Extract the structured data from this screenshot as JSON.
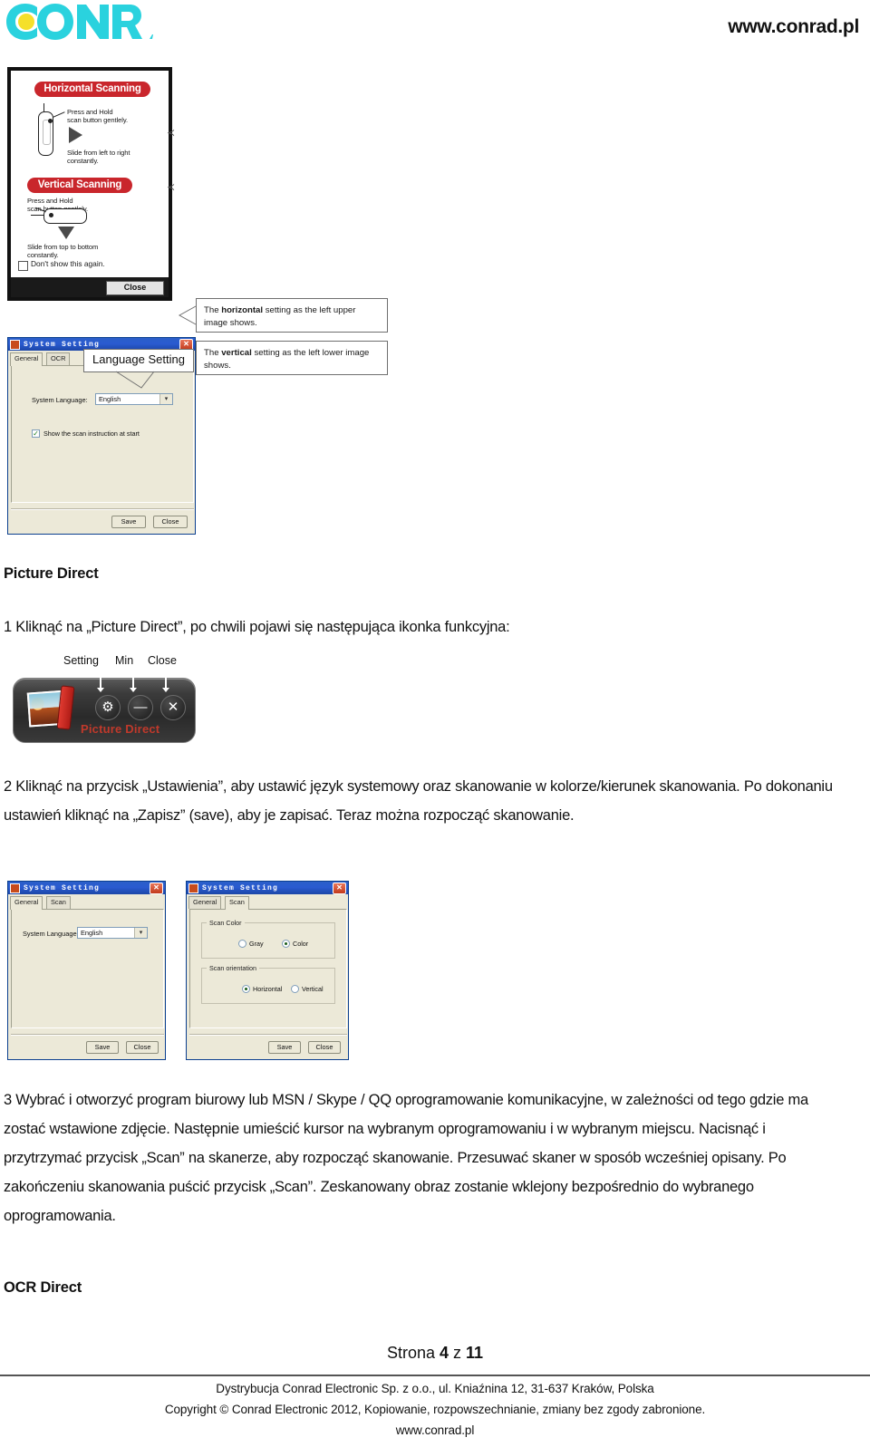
{
  "header": {
    "logo_text": "CONRAD",
    "logo_color": "#2ad2de",
    "logo_accent": "#f5e02a",
    "site_url": "www.conrad.pl"
  },
  "scan_instruction": {
    "horizontal_badge": "Horizontal Scanning",
    "horizontal_press": "Press and Hold",
    "horizontal_press2": "scan button gentlely.",
    "horizontal_slide": "Slide from left to right",
    "horizontal_slide2": "constantly.",
    "vertical_badge": "Vertical Scanning",
    "vertical_press": "Press and Hold",
    "vertical_press2": "scan button gentlely.",
    "vertical_slide": "Slide from top to bottom",
    "vertical_slide2": "constantly.",
    "dont_show": "Don't show this again.",
    "close_button": "Close",
    "badge_color": "#c9262c",
    "callouts": [
      {
        "prefix": "The ",
        "bold": "horizontal",
        "suffix": " setting as the left upper image shows."
      },
      {
        "prefix": "The ",
        "bold": "vertical",
        "suffix": " setting as the left lower image shows."
      }
    ]
  },
  "dialog_language": {
    "title": "System Setting",
    "tabs": [
      "General",
      "OCR"
    ],
    "active_tab": "General",
    "language_label": "System Language:",
    "language_value": "English",
    "checkbox_label": "Show the scan instruction at start",
    "checkbox_checked": true,
    "save_button": "Save",
    "close_button": "Close",
    "callout": "Language Setting"
  },
  "dialog_general": {
    "title": "System Setting",
    "tabs": [
      "General",
      "Scan"
    ],
    "active_tab": "General",
    "language_label": "System Language:",
    "language_value": "English",
    "save_button": "Save",
    "close_button": "Close"
  },
  "dialog_scan": {
    "title": "System Setting",
    "tabs": [
      "General",
      "Scan"
    ],
    "active_tab": "Scan",
    "group_color": "Scan Color",
    "color_options": [
      "Gray",
      "Color"
    ],
    "color_selected": "Color",
    "group_orientation": "Scan orientation",
    "orientation_options": [
      "Horizontal",
      "Vertical"
    ],
    "orientation_selected": "Horizontal",
    "save_button": "Save",
    "close_button": "Close"
  },
  "picture_direct_widget": {
    "label_setting": "Setting",
    "label_min": "Min",
    "label_close": "Close",
    "title": "Picture Direct",
    "title_color": "#c0392b",
    "gear_icon": "gear-icon",
    "minus_icon": "minus-icon",
    "close_icon": "close-icon"
  },
  "content": {
    "heading_picture_direct": "Picture Direct",
    "step1": "1 Kliknąć na „Picture Direct”, po chwili pojawi się następująca ikonka funkcyjna:",
    "step2": "2 Kliknąć na przycisk „Ustawienia”, aby ustawić język systemowy oraz skanowanie w kolorze/kierunek skanowania. Po dokonaniu ustawień kliknąć na „Zapisz” (save), aby je zapisać. Teraz można rozpocząć skanowanie.",
    "step3": "3 Wybrać i otworzyć program biurowy lub MSN / Skype / QQ oprogramowanie komunikacyjne, w zależności od tego gdzie ma zostać wstawione zdjęcie. Następnie umieścić kursor na wybranym oprogramowaniu i w wybranym miejscu. Nacisnąć i przytrzymać przycisk „Scan” na skanerze, aby rozpocząć skanowanie. Przesuwać skaner w sposób wcześniej opisany. Po zakończeniu skanowania puścić przycisk „Scan”. Zeskanowany obraz zostanie wklejony bezpośrednio do wybranego oprogramowania.",
    "heading_ocr_direct": "OCR Direct"
  },
  "footer": {
    "page_prefix": "Strona ",
    "page_current": "4",
    "page_middle": " z ",
    "page_total": "11",
    "line1": "Dystrybucja Conrad Electronic Sp. z o.o., ul. Kniaźnina 12, 31-637 Kraków, Polska",
    "line2": "Copyright © Conrad Electronic 2012, Kopiowanie, rozpowszechnianie, zmiany bez zgody zabronione.",
    "line3": "www.conrad.pl"
  }
}
